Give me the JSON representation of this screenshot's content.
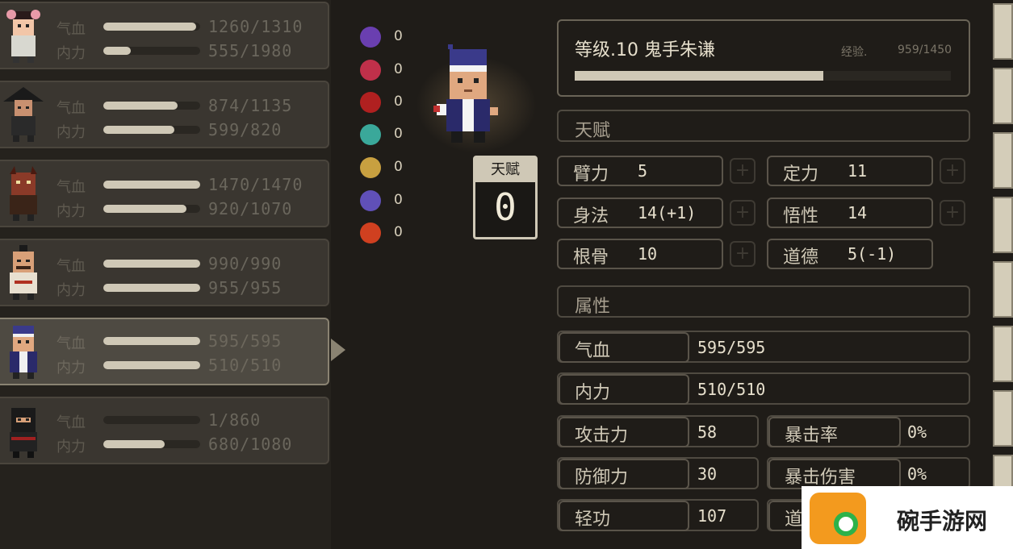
{
  "party": [
    {
      "hp_label": "气血",
      "hp": "1260/1310",
      "hp_pct": 0.96,
      "mp_label": "内力",
      "mp": "555/1980",
      "mp_pct": 0.28,
      "selected": false
    },
    {
      "hp_label": "气血",
      "hp": "874/1135",
      "hp_pct": 0.77,
      "mp_label": "内力",
      "mp": "599/820",
      "mp_pct": 0.73,
      "selected": false
    },
    {
      "hp_label": "气血",
      "hp": "1470/1470",
      "hp_pct": 1.0,
      "mp_label": "内力",
      "mp": "920/1070",
      "mp_pct": 0.86,
      "selected": false
    },
    {
      "hp_label": "气血",
      "hp": "990/990",
      "hp_pct": 1.0,
      "mp_label": "内力",
      "mp": "955/955",
      "mp_pct": 1.0,
      "selected": false
    },
    {
      "hp_label": "气血",
      "hp": "595/595",
      "hp_pct": 1.0,
      "mp_label": "内力",
      "mp": "510/510",
      "mp_pct": 1.0,
      "selected": true
    },
    {
      "hp_label": "气血",
      "hp": "1/860",
      "hp_pct": 0.0,
      "mp_label": "内力",
      "mp": "680/1080",
      "mp_pct": 0.63,
      "selected": false
    }
  ],
  "status_effects": [
    {
      "icon": "skull-icon",
      "count": "0",
      "color": "#6a3fb0"
    },
    {
      "icon": "broken-heart-icon",
      "count": "0",
      "color": "#c0304a"
    },
    {
      "icon": "bleed-icon",
      "count": "0",
      "color": "#b02020"
    },
    {
      "icon": "poison-icon",
      "count": "0",
      "color": "#3aa89a"
    },
    {
      "icon": "stun-icon",
      "count": "0",
      "color": "#c8a040"
    },
    {
      "icon": "confuse-icon",
      "count": "0",
      "color": "#6050b8"
    },
    {
      "icon": "burn-icon",
      "count": "0",
      "color": "#d04020"
    }
  ],
  "talent_points": {
    "label": "天赋",
    "value": "0"
  },
  "header": {
    "name": "等级.10 鬼手朱谦",
    "exp_label": "经验.",
    "exp_value": "959/1450",
    "exp_pct": 0.6614
  },
  "sections": {
    "talent": "天赋",
    "attributes": "属性"
  },
  "talents": [
    {
      "label": "臂力",
      "value": "5"
    },
    {
      "label": "定力",
      "value": "11"
    },
    {
      "label": "身法",
      "value": "14(+1)"
    },
    {
      "label": "悟性",
      "value": "14"
    },
    {
      "label": "根骨",
      "value": "10"
    },
    {
      "label": "道德",
      "value": "5(-1)"
    }
  ],
  "attributes": {
    "hp": {
      "label": "气血",
      "value": "595/595"
    },
    "mp": {
      "label": "内力",
      "value": "510/510"
    },
    "atk": {
      "label": "攻击力",
      "value": "58"
    },
    "crit": {
      "label": "暴击率",
      "value": "0%"
    },
    "def": {
      "label": "防御力",
      "value": "30"
    },
    "critdmg": {
      "label": "暴击伤害",
      "value": "0%"
    },
    "qinggong": {
      "label": "轻功",
      "value": "107"
    },
    "dodge_partial": {
      "label": "道"
    }
  },
  "watermark": {
    "text": "碗手游网"
  },
  "colors": {
    "accent": "#cfc8b6",
    "panel": "#3a3630",
    "selected": "#4e4a42",
    "bg": "#1f1c18"
  }
}
